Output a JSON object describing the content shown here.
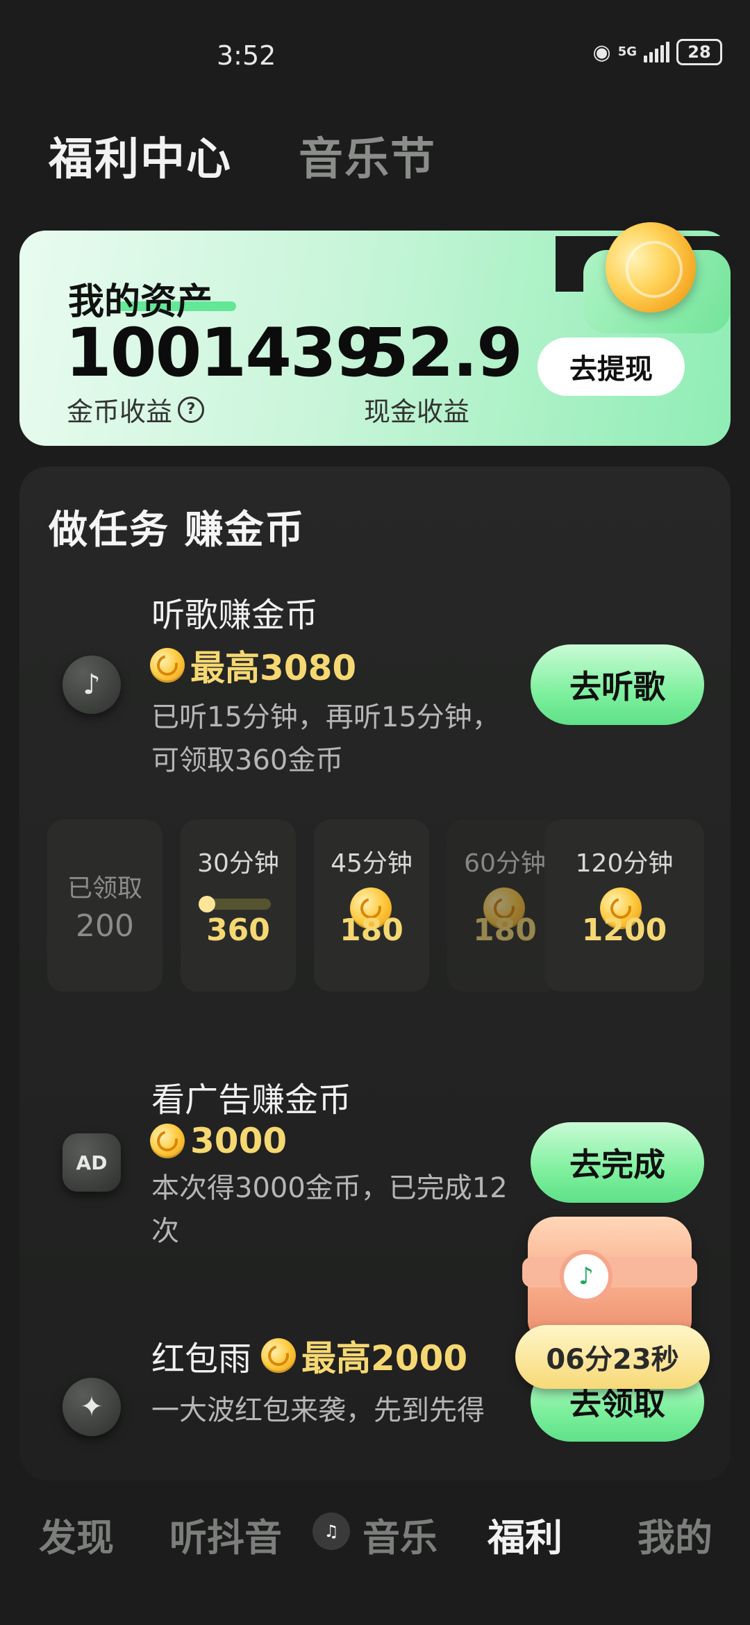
{
  "status_bar": {
    "time": "3:52",
    "network": "5G",
    "battery": "28"
  },
  "top_tabs": [
    {
      "label": "福利中心",
      "active": true
    },
    {
      "label": "音乐节",
      "active": false
    }
  ],
  "assets": {
    "title": "我的资产",
    "coin_value": "1001439",
    "coin_label": "金币收益",
    "cash_value": "52.9",
    "cash_label": "现金收益",
    "withdraw_label": "去提现"
  },
  "tasks": {
    "heading": "做任务 赚金币",
    "listen": {
      "title": "听歌赚金币",
      "reward": "最高3080",
      "desc": "已听15分钟，再听15分钟，可领取360金币",
      "button": "去听歌"
    },
    "milestones": [
      {
        "label": "已领取",
        "amount": "200",
        "state": "done"
      },
      {
        "label": "30分钟",
        "amount": "360",
        "state": "in-progress",
        "progress": 0.1
      },
      {
        "label": "45分钟",
        "amount": "180",
        "state": "locked"
      },
      {
        "label": "60分钟",
        "amount": "180",
        "state": "locked"
      },
      {
        "label": "120分钟",
        "amount": "1200",
        "state": "locked"
      }
    ],
    "ads": {
      "title": "看广告赚金币",
      "reward": "3000",
      "desc": "本次得3000金币，已完成12次",
      "button": "去完成",
      "icon_text": "AD"
    },
    "red_packet": {
      "title": "红包雨",
      "reward": "最高2000",
      "desc": "一大波红包来袭，先到先得",
      "button": "去领取"
    }
  },
  "chest_timer": "06分23秒",
  "bottom_nav": [
    {
      "label": "发现",
      "active": false
    },
    {
      "label": "听抖音",
      "active": false
    },
    {
      "label": "音乐",
      "active": false
    },
    {
      "label": "福利",
      "active": true
    },
    {
      "label": "我的",
      "active": false
    }
  ],
  "colors": {
    "accent_green": "#7ff09e",
    "gold": "#f6d873",
    "background": "#1b1c1b"
  }
}
